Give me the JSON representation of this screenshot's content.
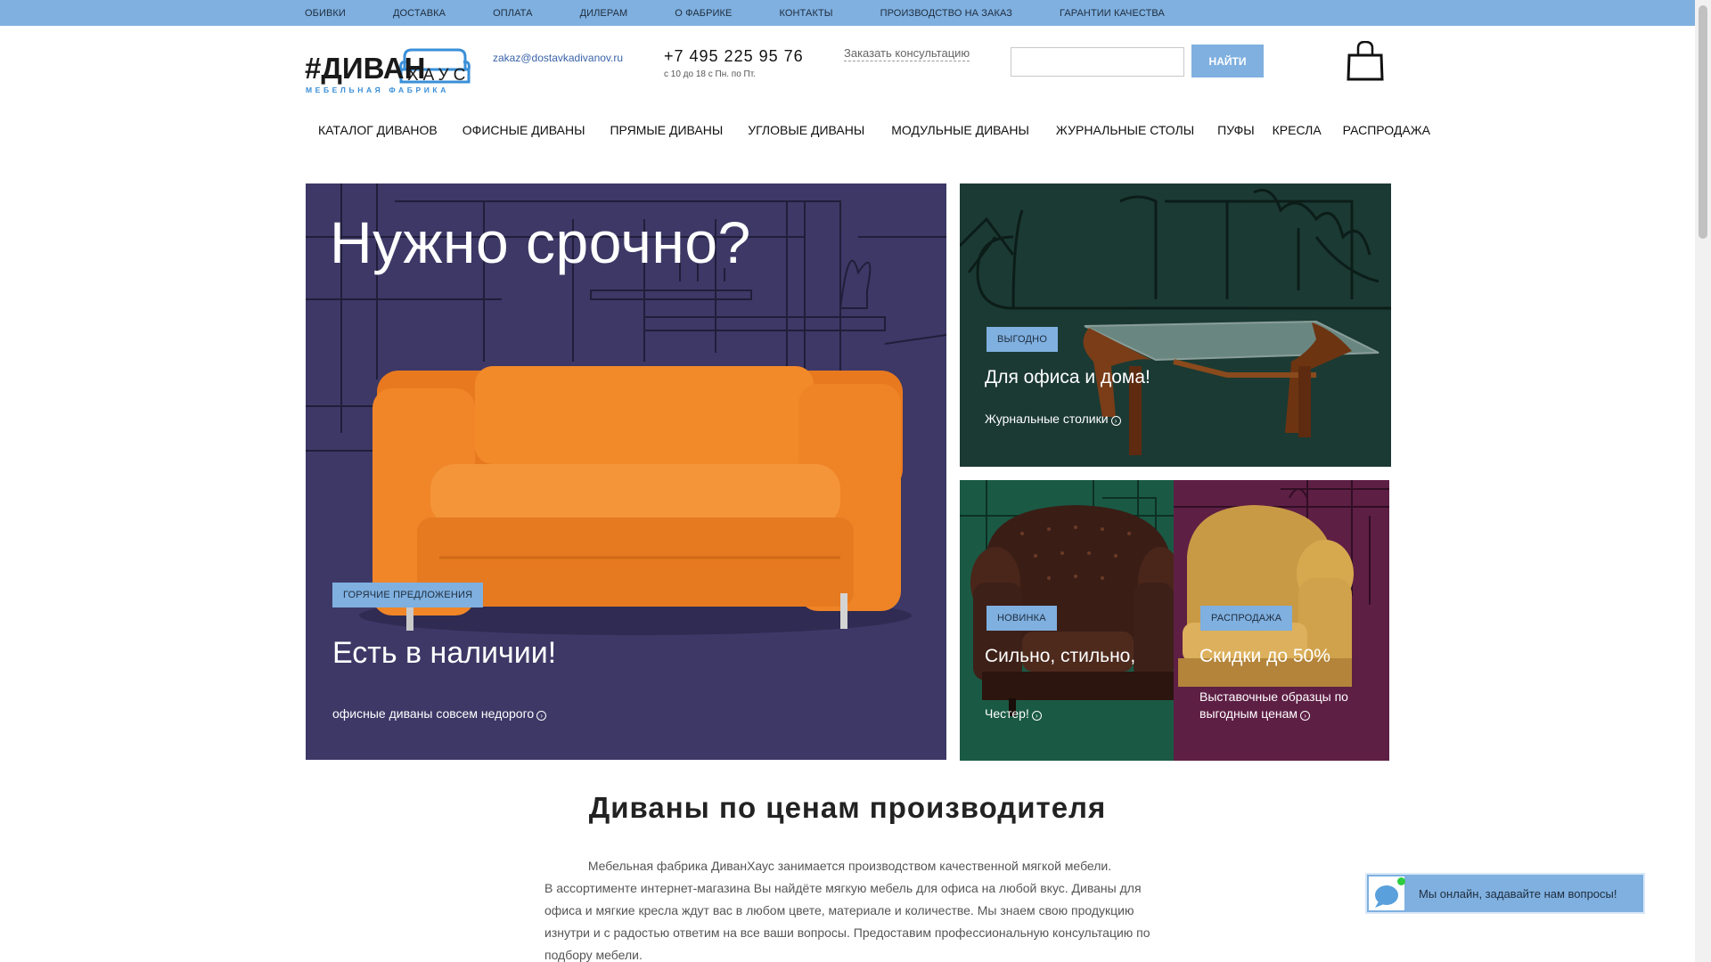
{
  "top_links": [
    "ОБИВКИ",
    "ДОСТАВКА",
    "ОПЛАТА",
    "ДИЛЕРАМ",
    "О ФАБРИКЕ",
    "КОНТАКТЫ",
    "ПРОИЗВОДСТВО НА ЗАКАЗ",
    "ГАРАНТИИ КАЧЕСТВА"
  ],
  "header": {
    "logo_main": "#ДИВАН",
    "logo_accent": "ХАУС",
    "logo_sub": "МЕБЕЛЬНАЯ ФАБРИКА",
    "email": "zakaz@dostavkadivanov.ru",
    "phone": "+7 495 225 95 76",
    "phone_hours": "с 10 до 18 с Пн. по Пт.",
    "consult": "Заказать консультацию",
    "search_value": "",
    "search_button": "НАЙТИ"
  },
  "nav": [
    "КАТАЛОГ ДИВАНОВ",
    "ОФИСНЫЕ ДИВАНЫ",
    "ПРЯМЫЕ ДИВАНЫ",
    "УГЛОВЫЕ ДИВАНЫ",
    "МОДУЛЬНЫЕ ДИВАНЫ",
    "ЖУРНАЛЬНЫЕ СТОЛЫ",
    "ПУФЫ",
    "КРЕСЛА",
    "РАСПРОДАЖА"
  ],
  "banners": {
    "main": {
      "headline": "Нужно срочно?",
      "badge": "ГОРЯЧИЕ ПРЕДЛОЖЕНИЯ",
      "title": "Есть в наличии!",
      "link": "офисные диваны совсем недорого"
    },
    "table": {
      "badge": "ВЫГОДНО",
      "title": "Для офиса и дома!",
      "link": "Журнальные столики"
    },
    "chester": {
      "badge": "НОВИНКА",
      "title": "Сильно, стильно,",
      "link": "Честер!"
    },
    "sale": {
      "badge": "РАСПРОДАЖА",
      "title": "Скидки до 50%",
      "link_line1": "Выставочные образцы по",
      "link_line2": "выгодным ценам"
    }
  },
  "section": {
    "title": "Диваны по ценам производителя",
    "intro_first": "Мебельная фабрика ДиванХаус занимается производством качественной мягкой мебели.",
    "intro_rest": "В ассортименте интернет-магазина Вы найдёте мягкую мебель для офиса на любой вкус. Диваны для офиса и мягкие кресла ждут вас в любом цвете, материале и количестве. Мы знаем свою продукцию изнутри и с радостью ответим на все ваши вопросы. Предоставим профессиональную консультацию по подбору мебели."
  },
  "chat": {
    "text": "Мы онлайн, задавайте нам вопросы!"
  },
  "colors": {
    "accent": "#7fb0e0",
    "banner_main_bg": "#3d3866",
    "banner_table_bg": "#1b3a33",
    "banner_chester_bg": "#1a5a45",
    "banner_sale_bg": "#5e1f45",
    "sofa_orange": "#f28a2a"
  }
}
